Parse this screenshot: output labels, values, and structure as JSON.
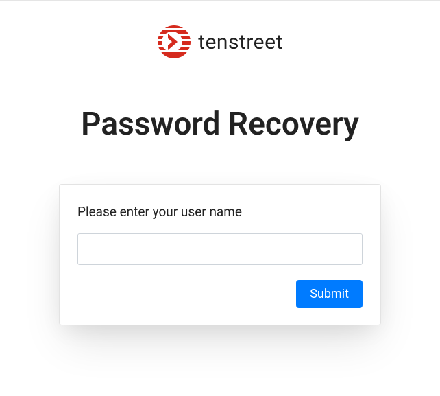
{
  "brand": {
    "name": "tenstreet"
  },
  "page": {
    "title": "Password Recovery"
  },
  "form": {
    "prompt": "Please enter your user name",
    "username_value": "",
    "submit_label": "Submit"
  }
}
